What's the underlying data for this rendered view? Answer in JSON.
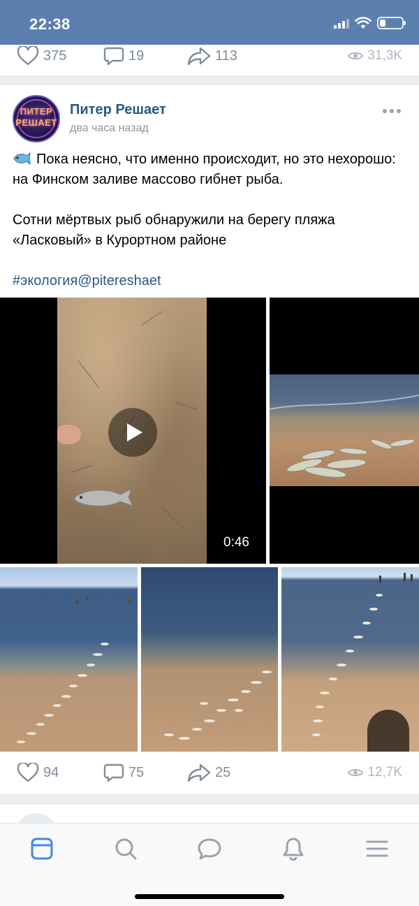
{
  "status_bar": {
    "time": "22:38",
    "signal_icon": "cellular-signal-icon",
    "wifi_icon": "wifi-icon",
    "battery_icon": "battery-icon",
    "battery_level": 0.25
  },
  "previous_post": {
    "likes": "375",
    "comments": "19",
    "shares": "113",
    "views": "31,3K"
  },
  "post": {
    "author": "Питер Решает",
    "avatar_text_line1": "ПИТЕР",
    "avatar_text_line2": "РЕШАЕТ",
    "time": "два часа назад",
    "emoji": "fish-emoji",
    "paragraph1": "Пока неясно, что именно происходит, но это нехорошо: на Финском заливе массово гибнет рыба.",
    "paragraph2": "Сотни мёртвых рыб обнаружили на берегу пляжа «Ласковый» в Курортном районе",
    "hashtag": "#экология@pitereshaet",
    "video_duration": "0:46",
    "likes": "94",
    "comments": "75",
    "shares": "25",
    "views": "12,7K"
  },
  "tab_bar": {
    "tabs": [
      "news-icon",
      "search-icon",
      "messages-icon",
      "notifications-icon",
      "menu-icon"
    ],
    "active": "news-icon"
  },
  "colors": {
    "header": "#5b7faf",
    "link": "#2a5885",
    "active_tab": "#3f8ae0",
    "icon_gray": "#818c99"
  }
}
